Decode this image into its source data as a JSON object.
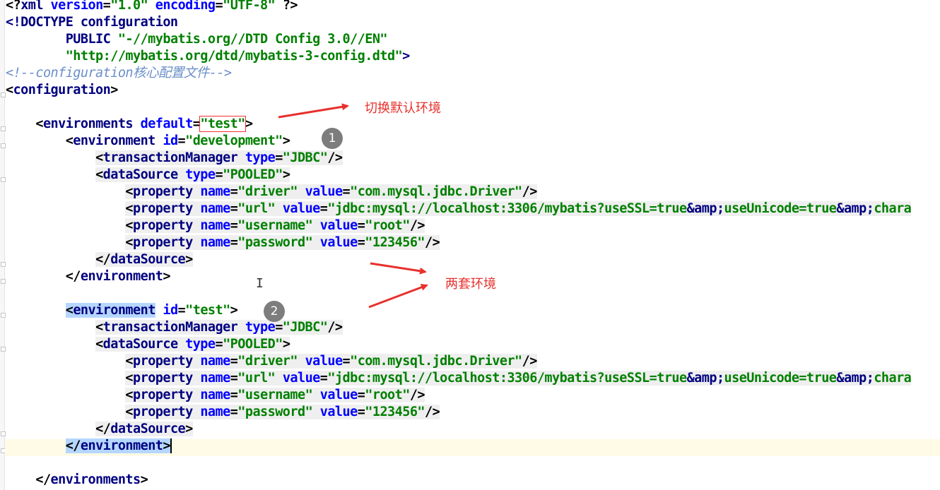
{
  "editor": {
    "lines": [
      [
        [
          "pn",
          "<?"
        ],
        [
          "tg",
          "xml"
        ],
        [
          "an",
          " version"
        ],
        [
          "pn",
          "="
        ],
        [
          "av",
          "\"1.0\""
        ],
        [
          "an",
          " encoding"
        ],
        [
          "pn",
          "="
        ],
        [
          "av",
          "\"UTF-8\""
        ],
        [
          "pn",
          " ?>"
        ]
      ],
      [
        [
          "tg",
          "<!DOCTYPE configuration"
        ]
      ],
      [
        [
          "tg",
          "        PUBLIC "
        ],
        [
          "av",
          "\"-//mybatis.org//DTD Config 3.0//EN\""
        ]
      ],
      [
        [
          "av",
          "        \"http://mybatis.org/dtd/mybatis-3-config.dtd\""
        ],
        [
          "tg",
          ">"
        ]
      ],
      [
        [
          "cm",
          "<!--configuration核心配置文件-->"
        ]
      ],
      [
        [
          "pn",
          "<"
        ],
        [
          "tg",
          "configuration"
        ],
        [
          "pn",
          ">"
        ]
      ],
      [],
      [
        [
          "pn",
          "    <"
        ],
        [
          "tg",
          "environments"
        ],
        [
          "an",
          " default"
        ],
        [
          "pn",
          "="
        ],
        [
          "av redbox",
          "\"test\""
        ],
        [
          "pn",
          ">"
        ]
      ],
      [
        [
          "pn",
          "        <"
        ],
        [
          "tg",
          "environment"
        ],
        [
          "an",
          " id"
        ],
        [
          "pn",
          "="
        ],
        [
          "av",
          "\"development\""
        ],
        [
          "pn",
          ">"
        ]
      ],
      [
        [
          "pn",
          "            "
        ],
        [
          "pn bgt",
          "<"
        ],
        [
          "tg bgt",
          "transactionManager"
        ],
        [
          "an bgt",
          " type"
        ],
        [
          "pn bgt",
          "="
        ],
        [
          "av bgt",
          "\"JDBC\""
        ],
        [
          "pn bgt",
          "/>"
        ]
      ],
      [
        [
          "pn",
          "            "
        ],
        [
          "pn bgt",
          "<"
        ],
        [
          "tg bgt",
          "dataSource"
        ],
        [
          "an bgt",
          " type"
        ],
        [
          "pn bgt",
          "="
        ],
        [
          "av bgt",
          "\"POOLED\""
        ],
        [
          "pn bgt",
          ">"
        ]
      ],
      [
        [
          "pn",
          "                "
        ],
        [
          "pn bgt",
          "<"
        ],
        [
          "tg bgt",
          "property"
        ],
        [
          "an bgt",
          " name"
        ],
        [
          "pn bgt",
          "="
        ],
        [
          "av bgt",
          "\"driver\""
        ],
        [
          "an bgt",
          " value"
        ],
        [
          "pn bgt",
          "="
        ],
        [
          "av bgt",
          "\"com.mysql.jdbc.Driver\""
        ],
        [
          "pn bgt",
          "/>"
        ]
      ],
      [
        [
          "pn",
          "                "
        ],
        [
          "pn bgt",
          "<"
        ],
        [
          "tg bgt",
          "property"
        ],
        [
          "an bgt",
          " name"
        ],
        [
          "pn bgt",
          "="
        ],
        [
          "av bgt",
          "\"url\""
        ],
        [
          "an bgt",
          " value"
        ],
        [
          "pn bgt",
          "="
        ],
        [
          "av bgt",
          "\"jdbc:mysql://localhost:3306/mybatis?useSSL=true"
        ],
        [
          "tg bgt",
          "&amp;"
        ],
        [
          "av bgt",
          "useUnicode=true"
        ],
        [
          "tg bgt",
          "&amp;"
        ],
        [
          "av bgt",
          "chara"
        ]
      ],
      [
        [
          "pn",
          "                "
        ],
        [
          "pn bgt",
          "<"
        ],
        [
          "tg bgt",
          "property"
        ],
        [
          "an bgt",
          " name"
        ],
        [
          "pn bgt",
          "="
        ],
        [
          "av bgt",
          "\"username\""
        ],
        [
          "an bgt",
          " value"
        ],
        [
          "pn bgt",
          "="
        ],
        [
          "av bgt",
          "\"root\""
        ],
        [
          "pn bgt",
          "/>"
        ]
      ],
      [
        [
          "pn",
          "                "
        ],
        [
          "pn bgt",
          "<"
        ],
        [
          "tg bgt",
          "property"
        ],
        [
          "an bgt",
          " name"
        ],
        [
          "pn bgt",
          "="
        ],
        [
          "av bgt",
          "\"password\""
        ],
        [
          "an bgt",
          " value"
        ],
        [
          "pn bgt",
          "="
        ],
        [
          "av bgt",
          "\"123456\""
        ],
        [
          "pn bgt",
          "/>"
        ]
      ],
      [
        [
          "pn",
          "            "
        ],
        [
          "pn bgt",
          "</"
        ],
        [
          "tg bgt",
          "dataSource"
        ],
        [
          "pn bgt",
          ">"
        ]
      ],
      [
        [
          "pn",
          "        </"
        ],
        [
          "tg",
          "environment"
        ],
        [
          "pn",
          ">"
        ]
      ],
      [],
      [
        [
          "pn",
          "        "
        ],
        [
          "pn hl",
          "<"
        ],
        [
          "tg hl",
          "environment"
        ],
        [
          "an",
          " id"
        ],
        [
          "pn",
          "="
        ],
        [
          "av",
          "\"test\""
        ],
        [
          "pn",
          ">"
        ]
      ],
      [
        [
          "pn",
          "            "
        ],
        [
          "pn bgt",
          "<"
        ],
        [
          "tg bgt",
          "transactionManager"
        ],
        [
          "an bgt",
          " type"
        ],
        [
          "pn bgt",
          "="
        ],
        [
          "av bgt",
          "\"JDBC\""
        ],
        [
          "pn bgt",
          "/>"
        ]
      ],
      [
        [
          "pn",
          "            "
        ],
        [
          "pn bgt",
          "<"
        ],
        [
          "tg bgt",
          "dataSource"
        ],
        [
          "an bgt",
          " type"
        ],
        [
          "pn bgt",
          "="
        ],
        [
          "av bgt",
          "\"POOLED\""
        ],
        [
          "pn bgt",
          ">"
        ]
      ],
      [
        [
          "pn",
          "                "
        ],
        [
          "pn bgt",
          "<"
        ],
        [
          "tg bgt",
          "property"
        ],
        [
          "an bgt",
          " name"
        ],
        [
          "pn bgt",
          "="
        ],
        [
          "av bgt",
          "\"driver\""
        ],
        [
          "an bgt",
          " value"
        ],
        [
          "pn bgt",
          "="
        ],
        [
          "av bgt",
          "\"com.mysql.jdbc.Driver\""
        ],
        [
          "pn bgt",
          "/>"
        ]
      ],
      [
        [
          "pn",
          "                "
        ],
        [
          "pn bgt",
          "<"
        ],
        [
          "tg bgt",
          "property"
        ],
        [
          "an bgt",
          " name"
        ],
        [
          "pn bgt",
          "="
        ],
        [
          "av bgt",
          "\"url\""
        ],
        [
          "an bgt",
          " value"
        ],
        [
          "pn bgt",
          "="
        ],
        [
          "av bgt",
          "\"jdbc:mysql://localhost:3306/mybatis?useSSL=true"
        ],
        [
          "tg bgt",
          "&amp;"
        ],
        [
          "av bgt",
          "useUnicode=true"
        ],
        [
          "tg bgt",
          "&amp;"
        ],
        [
          "av bgt",
          "chara"
        ]
      ],
      [
        [
          "pn",
          "                "
        ],
        [
          "pn bgt",
          "<"
        ],
        [
          "tg bgt",
          "property"
        ],
        [
          "an bgt",
          " name"
        ],
        [
          "pn bgt",
          "="
        ],
        [
          "av bgt",
          "\"username\""
        ],
        [
          "an bgt",
          " value"
        ],
        [
          "pn bgt",
          "="
        ],
        [
          "av bgt",
          "\"root\""
        ],
        [
          "pn bgt",
          "/>"
        ]
      ],
      [
        [
          "pn",
          "                "
        ],
        [
          "pn bgt",
          "<"
        ],
        [
          "tg bgt",
          "property"
        ],
        [
          "an bgt",
          " name"
        ],
        [
          "pn bgt",
          "="
        ],
        [
          "av bgt",
          "\"password\""
        ],
        [
          "an bgt",
          " value"
        ],
        [
          "pn bgt",
          "="
        ],
        [
          "av bgt",
          "\"123456\""
        ],
        [
          "pn bgt",
          "/>"
        ]
      ],
      [
        [
          "pn",
          "            "
        ],
        [
          "pn bgt",
          "</"
        ],
        [
          "tg bgt",
          "dataSource"
        ],
        [
          "pn bgt",
          ">"
        ]
      ],
      [
        [
          "pn",
          "        "
        ],
        [
          "pn hl",
          "</"
        ],
        [
          "tg hl",
          "environment"
        ],
        [
          "pn hl caret",
          ">"
        ]
      ],
      [],
      [
        [
          "pn",
          "    </"
        ],
        [
          "tg",
          "environments"
        ],
        [
          "pn",
          ">"
        ]
      ]
    ]
  },
  "annotations": {
    "switch_default_env": "切换默认环境",
    "two_envs": "两套环境",
    "badge_1": "1",
    "badge_2": "2"
  },
  "colors": {
    "annotation_red": "#e8302c",
    "tag": "#000080",
    "attr_name": "#0000ff",
    "attr_value": "#008000",
    "comment": "#6a8fc8",
    "selection": "#b5d7ff",
    "current_line": "#fffbe6"
  }
}
